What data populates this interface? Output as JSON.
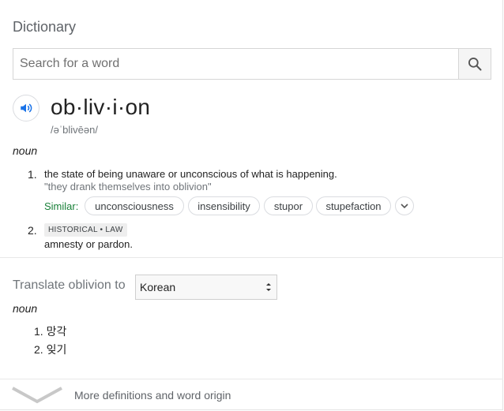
{
  "dictionary": {
    "title": "Dictionary",
    "search": {
      "placeholder": "Search for a word",
      "value": ""
    },
    "entry": {
      "headword": "ob·liv·i·on",
      "phonetic": "/əˈblivēən/",
      "pos": "noun",
      "senses": [
        {
          "number": "1.",
          "definition": "the state of being unaware or unconscious of what is happening.",
          "example": "\"they drank themselves into oblivion\"",
          "similar_label": "Similar:",
          "similar": [
            "unconsciousness",
            "insensibility",
            "stupor",
            "stupefaction"
          ]
        },
        {
          "number": "2.",
          "tag": "HISTORICAL • LAW",
          "definition": "amnesty or pardon."
        }
      ]
    },
    "translate": {
      "label": "Translate oblivion to",
      "language": "Korean",
      "pos": "noun",
      "items": [
        "1. 망각",
        "2. 잊기"
      ]
    },
    "more_label": "More definitions and word origin"
  },
  "colors": {
    "accent": "#1a73e8",
    "similar_green": "#188038",
    "muted": "#70757a"
  },
  "icons": [
    "search-icon",
    "speaker-icon",
    "chevron-down-icon",
    "select-arrows-icon"
  ]
}
